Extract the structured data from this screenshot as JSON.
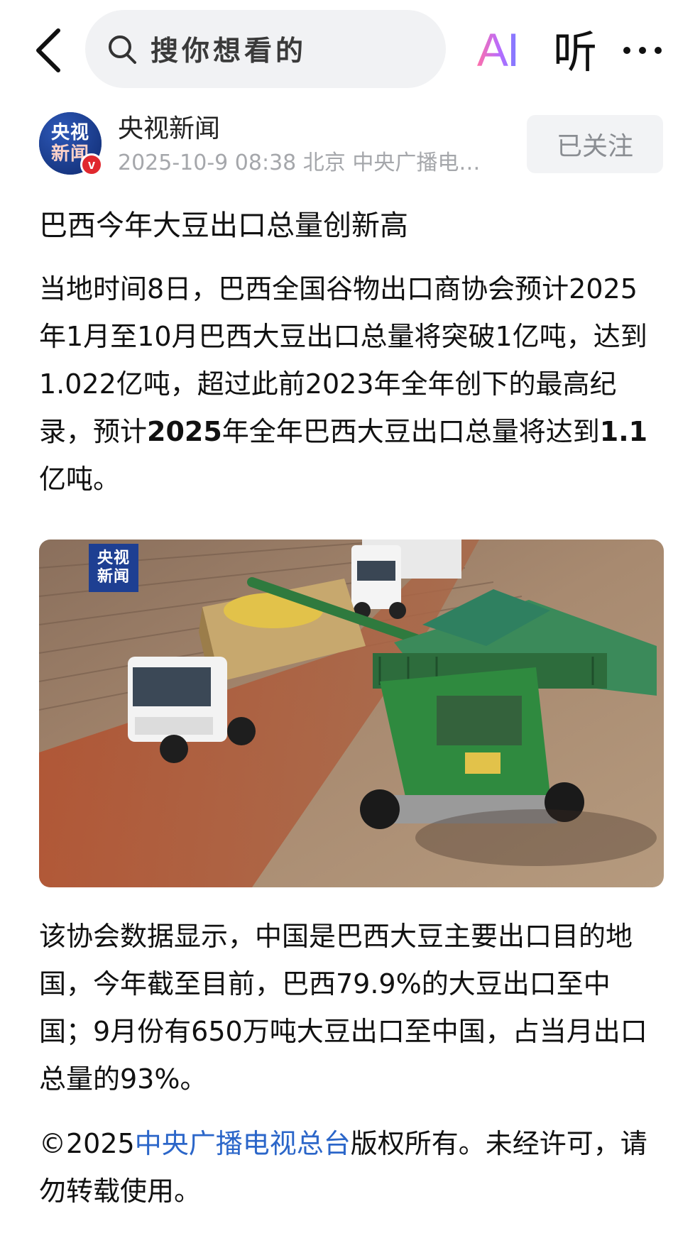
{
  "topbar": {
    "search_placeholder": "搜你想看的",
    "ai_label": "AI",
    "listen_label": "听"
  },
  "author": {
    "avatar_line1": "央视",
    "avatar_line2": "新闻",
    "verified_mark": "v",
    "name": "央视新闻",
    "meta": "2025-10-9  08:38  北京  中央广播电…",
    "follow_label": "已关注"
  },
  "article": {
    "title": "巴西今年大豆出口总量创新高",
    "p1_a": "当地时间8日，巴西全国谷物出口商协会预计2025年1月至10月巴西大豆出口总量将突破1亿吨，达到1.022亿吨，超过此前2023年全年创下的最高纪录，预计",
    "p1_bold1": "2025",
    "p1_b": "年全年巴西大豆出口总量将达到",
    "p1_bold2": "1.1",
    "p1_c": "亿吨。",
    "image_watermark_line1": "央视",
    "image_watermark_line2": "新闻",
    "p2": "该协会数据显示，中国是巴西大豆主要出口目的地国，今年截至目前，巴西79.9%的大豆出口至中国；9月份有650万吨大豆出口至中国，占当月出口总量的93%。",
    "p3_a": "©2025",
    "p3_link": "中央广播电视总台",
    "p3_b": "版权所有。未经许可，请勿转载使用。"
  },
  "colors": {
    "link": "#2b66c9",
    "verified": "#e0282e",
    "follow_bg": "#f2f3f5",
    "meta_text": "#a5a7ab"
  },
  "icons": [
    "back-arrow-icon",
    "search-icon",
    "more-dots-icon",
    "verified-icon"
  ]
}
